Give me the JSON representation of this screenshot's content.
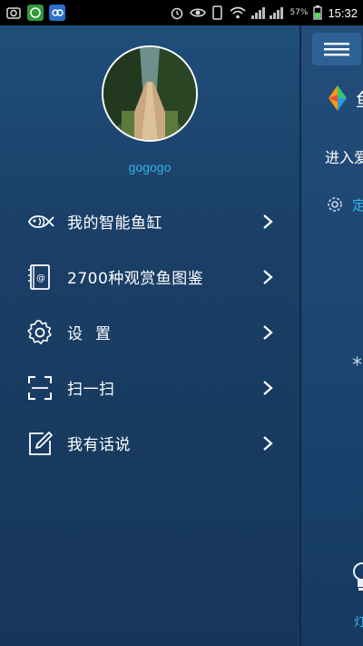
{
  "status_bar": {
    "time": "15:32",
    "battery": "57%",
    "apps": [
      "screenshot-icon",
      "wechat-icon",
      "qq-icon"
    ]
  },
  "drawer": {
    "username": "gogogo",
    "menu_items": [
      {
        "label": "我的智能鱼缸",
        "icon": "fish-icon"
      },
      {
        "label": "2700种观赏鱼图鉴",
        "icon": "book-icon"
      },
      {
        "label": "设置",
        "icon": "gear-icon"
      },
      {
        "label": "扫一扫",
        "icon": "scan-icon"
      },
      {
        "label": "我有话说",
        "icon": "edit-icon"
      }
    ]
  },
  "main": {
    "brand_char": "鱼",
    "enter_text": "进入爱",
    "setting_char": "定",
    "star_char": "*",
    "bottom_char": "灯"
  },
  "colors": {
    "accent": "#35b4e8",
    "drawer_bg": "#1a3f66"
  }
}
